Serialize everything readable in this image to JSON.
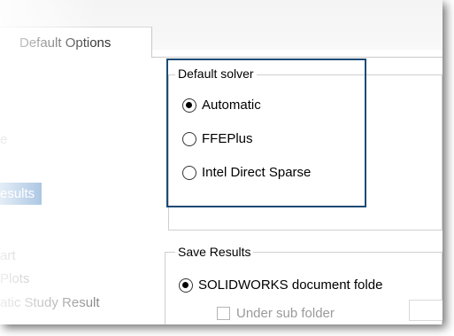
{
  "tab": {
    "label": "Default Options"
  },
  "tree": {
    "items": [
      {
        "label": "e"
      },
      {
        "label": "esults"
      },
      {
        "label": "art"
      },
      {
        "label": "Plots"
      },
      {
        "label": "atic Study Result"
      }
    ]
  },
  "default_solver": {
    "legend": "Default solver",
    "options": [
      {
        "label": "Automatic",
        "checked": true
      },
      {
        "label": "FFEPlus",
        "checked": false
      },
      {
        "label": "Intel Direct Sparse",
        "checked": false
      }
    ]
  },
  "save_results": {
    "legend": "Save Results",
    "options": [
      {
        "label": "SOLIDWORKS document folde",
        "checked": true
      }
    ],
    "sub_folder_checkbox": {
      "label": "Under sub folder",
      "checked": false
    }
  },
  "colors": {
    "highlight_border": "#1b4a75",
    "selected_bg": "#4b86c5"
  }
}
